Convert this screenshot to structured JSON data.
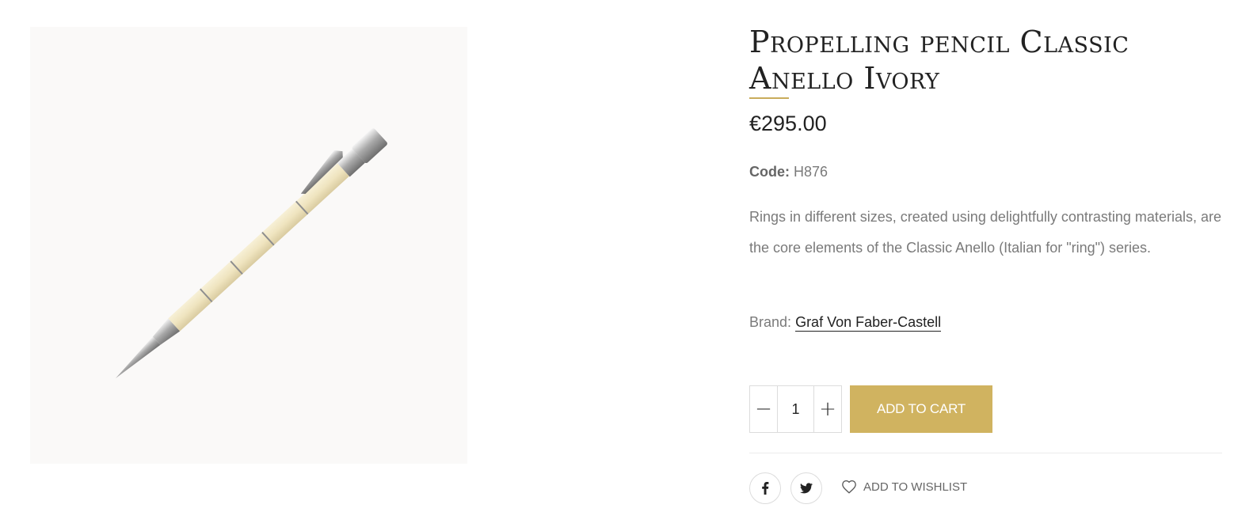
{
  "product": {
    "image_alt": "Propelling pencil Classic Anello Ivory",
    "title": "Propelling pencil Classic Anello Ivory",
    "price": "€295.00",
    "code_label": "Code:",
    "code_value": "H876",
    "description": "Rings in different sizes, created using delightfully contrasting materials, are the core elements of the Classic Anello (Italian for \"ring\") series.",
    "brand_label": "Brand:",
    "brand_name": "Graf Von Faber-Castell"
  },
  "cart": {
    "quantity": "1",
    "decrement_symbol": "−",
    "increment_symbol": "+",
    "add_to_cart_label": "ADD TO CART"
  },
  "share": {
    "facebook_icon": "facebook-icon",
    "twitter_icon": "twitter-icon",
    "wishlist_label": "ADD TO WISHLIST"
  },
  "colors": {
    "accent": "#d0b360",
    "title": "#222222",
    "text": "#7a7a7a"
  }
}
